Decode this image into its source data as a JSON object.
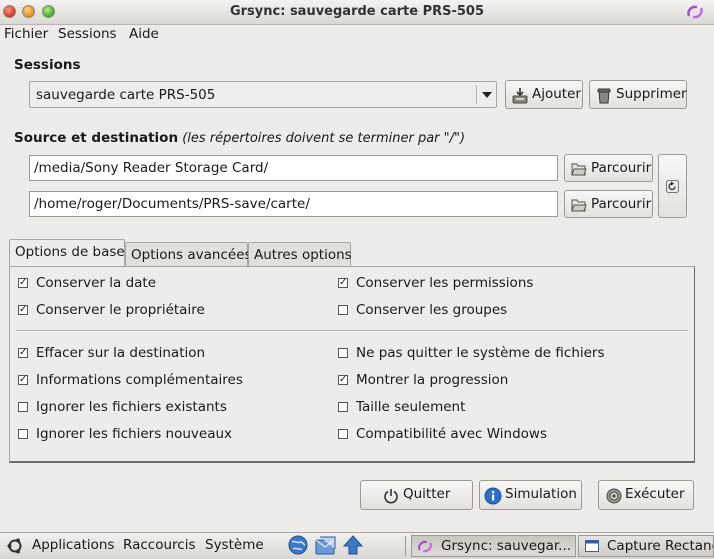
{
  "window": {
    "title": "Grsync: sauvegarde carte PRS-505"
  },
  "menubar": {
    "items": [
      "Fichier",
      "Sessions",
      "Aide"
    ]
  },
  "sessions": {
    "heading": "Sessions",
    "selected": "sauvegarde carte PRS-505",
    "add_label": "Ajouter",
    "delete_label": "Supprimer"
  },
  "source_dest": {
    "heading": "Source et destination",
    "note": "(les répertoires doivent se terminer par \"/\")",
    "source": "/media/Sony Reader Storage Card/",
    "destination": "/home/roger/Documents/PRS-save/carte/",
    "browse_label": "Parcourir"
  },
  "tabs": [
    "Options de base",
    "Options avancées",
    "Autres options"
  ],
  "options": {
    "left": [
      {
        "label": "Conserver la date",
        "checked": true
      },
      {
        "label": "Conserver le propriétaire",
        "checked": true
      },
      {
        "label": "Effacer sur la destination",
        "checked": true
      },
      {
        "label": "Informations complémentaires",
        "checked": true
      },
      {
        "label": "Ignorer les fichiers existants",
        "checked": false
      },
      {
        "label": "Ignorer les fichiers nouveaux",
        "checked": false
      }
    ],
    "right": [
      {
        "label": "Conserver les permissions",
        "checked": true
      },
      {
        "label": "Conserver les groupes",
        "checked": false
      },
      {
        "label": "Ne pas quitter le système de fichiers",
        "checked": false
      },
      {
        "label": "Montrer la progression",
        "checked": true
      },
      {
        "label": "Taille seulement",
        "checked": false
      },
      {
        "label": "Compatibilité avec Windows",
        "checked": false
      }
    ]
  },
  "actions": {
    "quit": "Quitter",
    "simulate": "Simulation",
    "execute": "Exécuter"
  },
  "taskbar": {
    "menus": [
      "Applications",
      "Raccourcis",
      "Système"
    ],
    "tasks": [
      "Grsync: sauvegar...",
      "Capture Rectang"
    ]
  },
  "colors": {
    "window_bg": "#edeceb",
    "info_blue": "#2a6fd0",
    "close_red": "#d7321e"
  }
}
